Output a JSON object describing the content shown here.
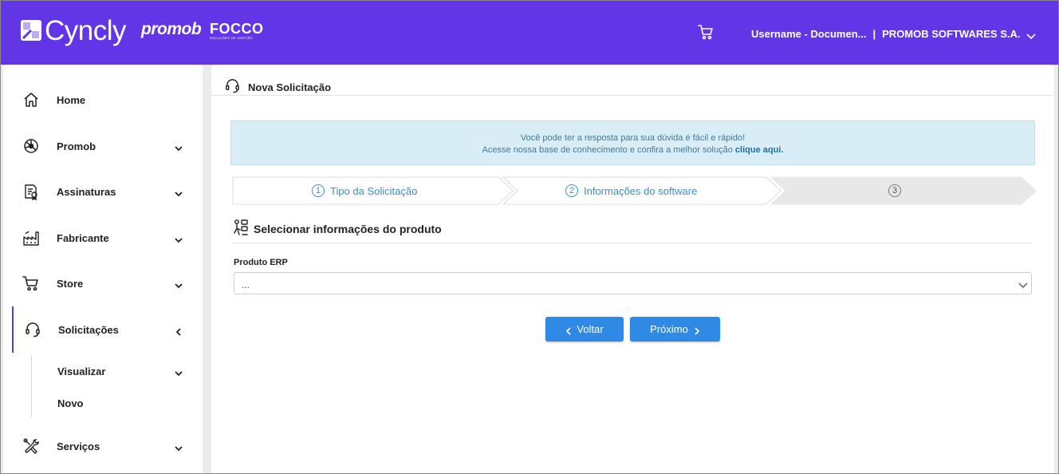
{
  "brand": {
    "cyncly": "Cyncly",
    "promob": "promob",
    "focco": "FOCCO",
    "focco_tagline": "SOLUÇÕES DE GESTÃO"
  },
  "header": {
    "cart_icon": "cart-icon",
    "username": "Username - Documen...",
    "separator": "|",
    "company": "PROMOB SOFTWARES S.A."
  },
  "sidebar": {
    "items": [
      {
        "label": "Home",
        "icon": "home-icon"
      },
      {
        "label": "Promob",
        "icon": "promob-icon"
      },
      {
        "label": "Assinaturas",
        "icon": "subscription-icon"
      },
      {
        "label": "Fabricante",
        "icon": "factory-icon"
      },
      {
        "label": "Store",
        "icon": "cart-icon"
      },
      {
        "label": "Solicitações",
        "icon": "headset-icon"
      },
      {
        "label": "Serviços",
        "icon": "tools-icon"
      }
    ],
    "sub_items": [
      {
        "label": "Visualizar"
      },
      {
        "label": "Novo"
      }
    ]
  },
  "main": {
    "title": "Nova Solicitação",
    "info": {
      "line1": "Você pode ter a resposta para sua dúvida é fácil e rápido!",
      "line2": "Acesse nossa base de conhecimento e confira a melhor solução",
      "link": "clique aqui."
    },
    "steps": [
      {
        "num": "1",
        "label": "Tipo da Solicitação",
        "state": "done"
      },
      {
        "num": "2",
        "label": "Informações do software",
        "state": "current"
      },
      {
        "num": "3",
        "label": "",
        "state": "pending"
      }
    ],
    "section_title": "Selecionar informações do produto",
    "field": {
      "label": "Produto ERP",
      "value": "..."
    },
    "buttons": {
      "back": "Voltar",
      "next": "Próximo"
    }
  },
  "colors": {
    "brand": "#6236e6",
    "primary_button": "#2f8ae5",
    "info_bg": "#d9edf7",
    "step_active_text": "#3a8fc7"
  }
}
